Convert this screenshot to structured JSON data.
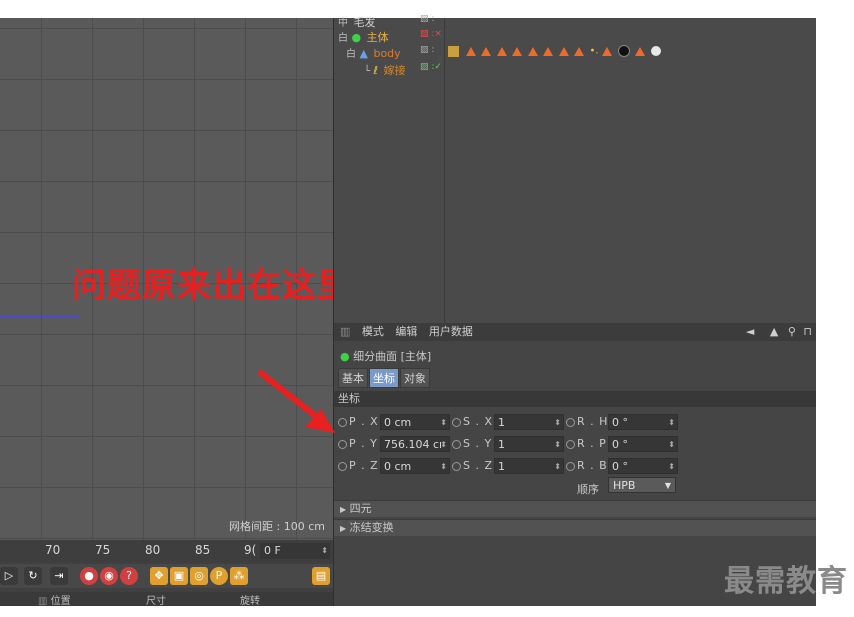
{
  "annotation": "问题原来出在这里",
  "viewport": {
    "grid_spacing": "网格间距 : 100 cm"
  },
  "object_manager": {
    "objects": [
      {
        "tree": "中",
        "name": "毛发",
        "flags": "▨ :"
      },
      {
        "tree": "白",
        "name": "主体",
        "flags": "▨ :×"
      },
      {
        "tree": "白",
        "name": "body",
        "flags": "▨ :"
      },
      {
        "tree": "└",
        "name": "嫁接",
        "flags": "▨ :✓"
      }
    ]
  },
  "attribute_manager": {
    "menu": [
      "模式",
      "编辑",
      "用户数据"
    ],
    "object_title": "细分曲面 [主体]",
    "tabs": [
      "基本",
      "坐标",
      "对象"
    ],
    "section_title": "坐标",
    "rows": [
      {
        "p_label": "P . X",
        "p_value": "0 cm",
        "s_label": "S . X",
        "s_value": "1",
        "r_label": "R . H",
        "r_value": "0 °"
      },
      {
        "p_label": "P . Y",
        "p_value": "756.104 cı",
        "s_label": "S . Y",
        "s_value": "1",
        "r_label": "R . P",
        "r_value": "0 °"
      },
      {
        "p_label": "P . Z",
        "p_value": "0 cm",
        "s_label": "S . Z",
        "s_value": "1",
        "r_label": "R . B",
        "r_value": "0 °"
      }
    ],
    "order_label": "顺序",
    "order_value": "HPB",
    "folds": [
      "四元",
      "冻结变换"
    ]
  },
  "timeline": {
    "ticks": [
      "70",
      "75",
      "80",
      "85",
      "9("
    ],
    "frame_value": "0 F",
    "coord_headers": [
      "位置",
      "尺寸",
      "旋转"
    ]
  },
  "watermark": "最需教育",
  "colors": {
    "annotation": "#e62020",
    "tab_active": "#7a9ac8",
    "arrow": "#e82020",
    "material_tri": "#f06a2c"
  }
}
